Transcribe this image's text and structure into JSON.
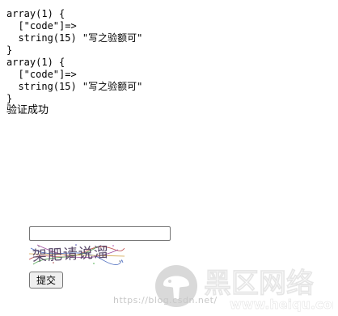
{
  "dumps": [
    "array(1) {\n  [\"code\"]=>\n  string(15) \"写之验额可\"\n}",
    "array(1) {\n  [\"code\"]=>\n  string(15) \"写之验额可\"\n}"
  ],
  "result_text": "验证成功",
  "form": {
    "input_value": "",
    "captcha_text": "架肥请说溜",
    "submit_label": "提交"
  },
  "watermark": {
    "brand_text": "黑区网络",
    "site_text": "www.heiqu.com",
    "url_text": "https://blog.csdn.net/",
    "brand_color": "#ffffff",
    "logo_circle_color": "#d9d9d9"
  }
}
